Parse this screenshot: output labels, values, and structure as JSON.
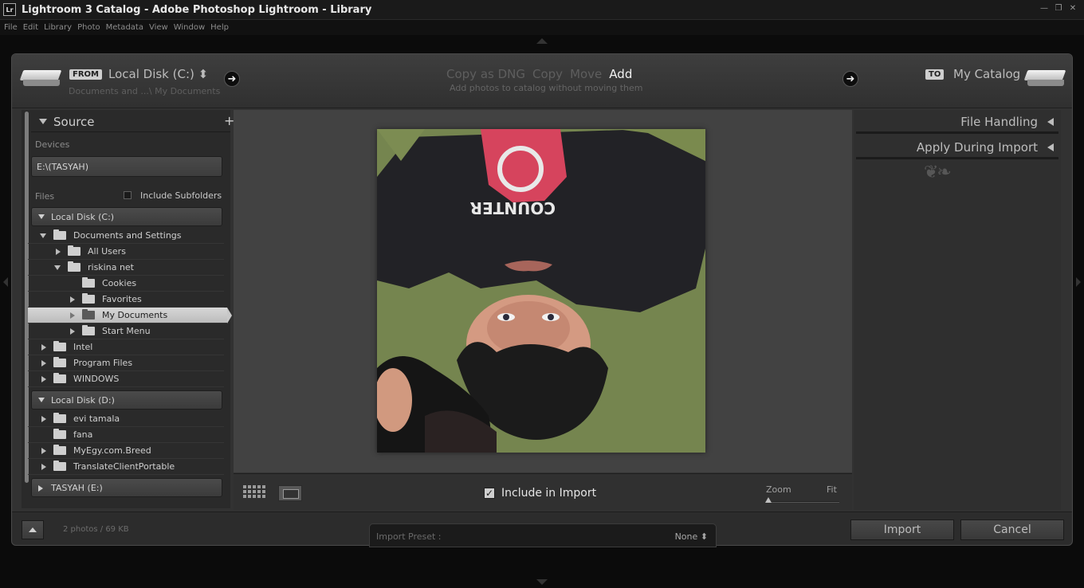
{
  "window": {
    "app_icon": "Lr",
    "title": "Lightroom 3 Catalog - Adobe Photoshop Lightroom - Library",
    "controls": [
      "minimize-icon",
      "restore-icon",
      "close-icon"
    ]
  },
  "menu": [
    "File",
    "Edit",
    "Library",
    "Photo",
    "Metadata",
    "View",
    "Window",
    "Help"
  ],
  "header": {
    "from_tag": "FROM",
    "source_name": "Local Disk (C:) ⬍",
    "source_path": "Documents and ...\\ My Documents",
    "modes": [
      {
        "label": "Copy as DNG",
        "active": false
      },
      {
        "label": "Copy",
        "active": false
      },
      {
        "label": "Move",
        "active": false
      },
      {
        "label": "Add",
        "active": true
      }
    ],
    "mode_description": "Add photos to catalog without moving them",
    "to_tag": "TO",
    "destination": "My Catalog"
  },
  "source_panel": {
    "title": "Source",
    "devices_label": "Devices",
    "device": "E:\\(TASYAH)",
    "files_label": "Files",
    "include_subfolders": "Include Subfolders",
    "disks": [
      {
        "name": "Local Disk (C:)",
        "folders": [
          {
            "label": "Documents and Settings"
          },
          {
            "label": "All Users"
          },
          {
            "label": "riskina net"
          },
          {
            "label": "Cookies"
          },
          {
            "label": "Favorites"
          },
          {
            "label": "My Documents"
          },
          {
            "label": "Start Menu"
          },
          {
            "label": "Intel"
          },
          {
            "label": "Program Files"
          },
          {
            "label": "WINDOWS"
          }
        ]
      },
      {
        "name": "Local Disk (D:)",
        "folders": [
          {
            "label": "evi tamala"
          },
          {
            "label": "fana"
          },
          {
            "label": "MyEgy.com.Breed"
          },
          {
            "label": "TranslateClientPortable"
          }
        ]
      },
      {
        "name": "TASYAH (E:)",
        "folders": []
      }
    ]
  },
  "preview": {
    "include_in_import": "Include in Import",
    "zoom_label": "Zoom",
    "fit_label": "Fit",
    "shirt_text": "COUNTER"
  },
  "right_panel": {
    "sections": [
      "File Handling",
      "Apply During Import"
    ]
  },
  "footer": {
    "photo_count": "2 photos / 69 KB",
    "preset_label": "Import Preset :",
    "preset_value": "None ⬍",
    "import_button": "Import",
    "cancel_button": "Cancel"
  },
  "colors": {
    "background": "#0b0b0b",
    "panel": "#2a2a2a",
    "dialog": "#323232",
    "active_text": "#f1f1f1",
    "selected_row": "#cfcfcf"
  }
}
